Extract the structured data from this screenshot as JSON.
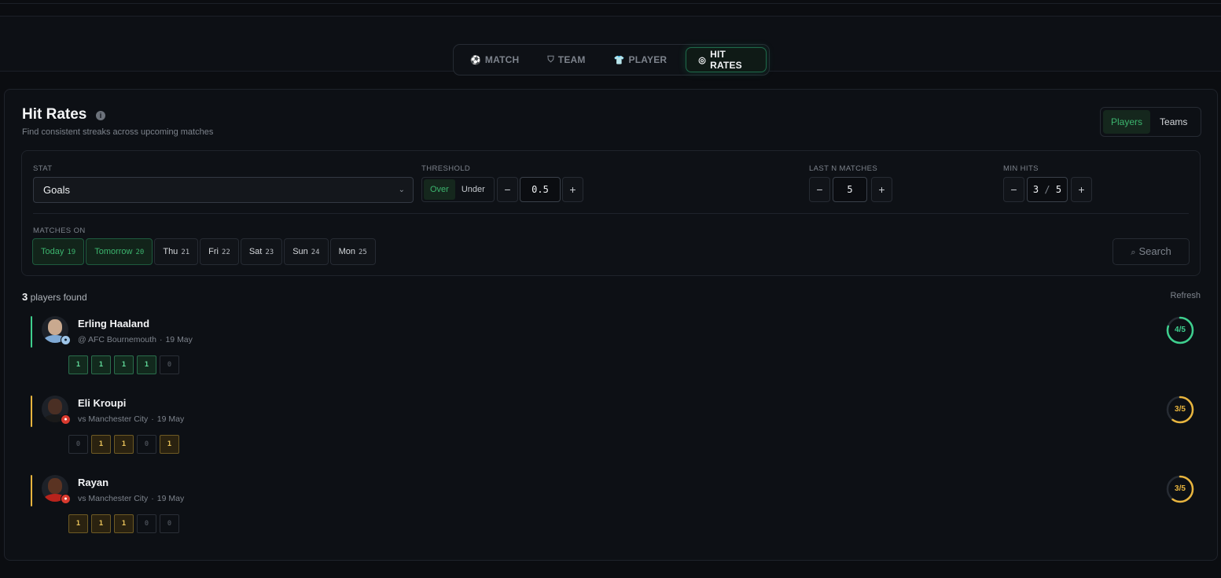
{
  "nav": {
    "tabs": [
      {
        "label": "MATCH",
        "icon": "soccer-ball-icon"
      },
      {
        "label": "TEAM",
        "icon": "shield-icon"
      },
      {
        "label": "PLAYER",
        "icon": "shirt-icon"
      },
      {
        "label": "HIT RATES",
        "icon": "target-icon",
        "active": true
      }
    ]
  },
  "header": {
    "title": "Hit Rates",
    "subtitle": "Find consistent streaks across upcoming matches",
    "toggle": {
      "players": "Players",
      "teams": "Teams",
      "active": "Players"
    }
  },
  "filters": {
    "stat": {
      "label": "STAT",
      "value": "Goals"
    },
    "threshold": {
      "label": "THRESHOLD",
      "over": "Over",
      "under": "Under",
      "active": "Over",
      "minus": "−",
      "value": "0.5",
      "plus": "+"
    },
    "last_n": {
      "label": "LAST N MATCHES",
      "minus": "−",
      "value": "5",
      "plus": "+"
    },
    "min_hits": {
      "label": "MIN HITS",
      "minus": "−",
      "value": "3",
      "sep": "/",
      "total": "5",
      "plus": "+"
    },
    "matches_on": {
      "label": "MATCHES ON",
      "days": [
        {
          "day": "Today",
          "num": "19",
          "active": true
        },
        {
          "day": "Tomorrow",
          "num": "20",
          "active": true
        },
        {
          "day": "Thu",
          "num": "21"
        },
        {
          "day": "Fri",
          "num": "22"
        },
        {
          "day": "Sat",
          "num": "23"
        },
        {
          "day": "Sun",
          "num": "24"
        },
        {
          "day": "Mon",
          "num": "25"
        }
      ]
    },
    "search_label": "Search"
  },
  "results": {
    "count": "3",
    "count_suffix": "players found",
    "refresh": "Refresh"
  },
  "players": [
    {
      "name": "Erling Haaland",
      "opponent": "@ AFC Bournemouth",
      "date": "19 May",
      "hits": [
        "1",
        "1",
        "1",
        "1",
        "0"
      ],
      "score": "4/5",
      "rate": 0.8,
      "color": "#3ecf8e",
      "tier": "g"
    },
    {
      "name": "Eli Kroupi",
      "opponent": "vs Manchester City",
      "date": "19 May",
      "hits": [
        "0",
        "1",
        "1",
        "0",
        "1"
      ],
      "score": "3/5",
      "rate": 0.6,
      "color": "#e8b53e",
      "tier": "y"
    },
    {
      "name": "Rayan",
      "opponent": "vs Manchester City",
      "date": "19 May",
      "hits": [
        "1",
        "1",
        "1",
        "0",
        "0"
      ],
      "score": "3/5",
      "rate": 0.6,
      "color": "#e8b53e",
      "tier": "y"
    }
  ],
  "colors": {
    "accent": "#3cb46e",
    "green": "#3ecf8e",
    "yellow": "#e8b53e",
    "bg": "#0b0d11"
  }
}
